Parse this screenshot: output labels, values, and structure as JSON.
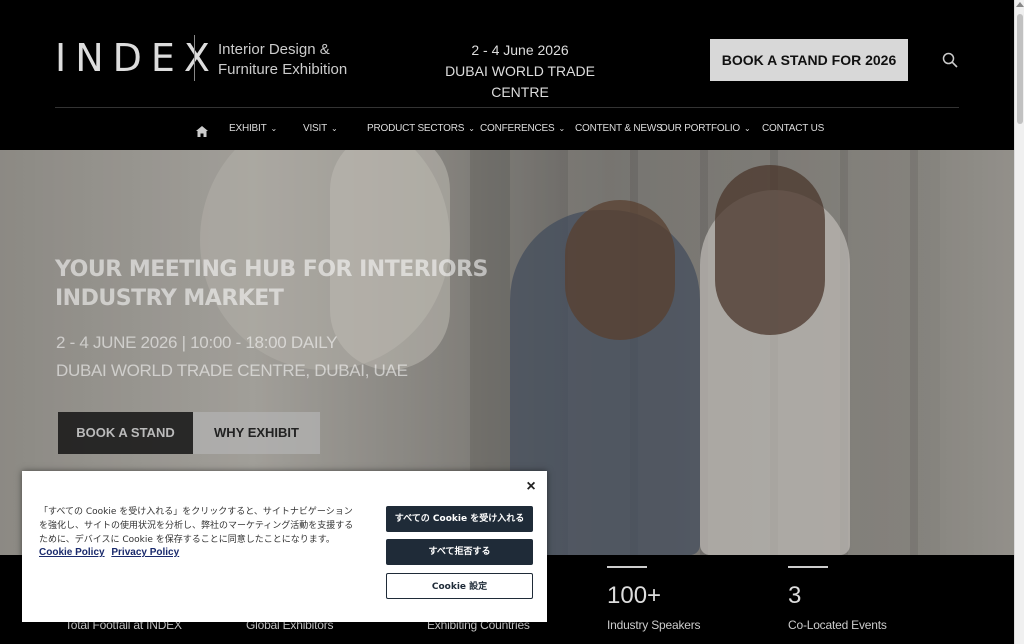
{
  "header": {
    "logo": "INDEX",
    "tagline_line1": "Interior Design &",
    "tagline_line2": "Furniture Exhibition",
    "dates": "2 - 4 June 2026",
    "venue": "DUBAI WORLD TRADE CENTRE",
    "book_button": "BOOK A STAND FOR 2026"
  },
  "nav": {
    "items": [
      {
        "label": "EXHIBIT",
        "dropdown": true
      },
      {
        "label": "VISIT",
        "dropdown": true
      },
      {
        "label": "PRODUCT SECTORS",
        "dropdown": true
      },
      {
        "label": "CONFERENCES",
        "dropdown": true
      },
      {
        "label": "CONTENT & NEWS",
        "dropdown": false
      },
      {
        "label": "OUR PORTFOLIO",
        "dropdown": true
      },
      {
        "label": "CONTACT US",
        "dropdown": false
      }
    ]
  },
  "hero": {
    "title_line1": "YOUR MEETING HUB FOR INTERIORS",
    "title_line2": "INDUSTRY MARKET",
    "date_line": "2 - 4 JUNE 2026 | 10:00 - 18:00 DAILY",
    "venue_line": "DUBAI WORLD TRADE CENTRE, DUBAI, UAE",
    "button_primary": "BOOK A STAND",
    "button_secondary": "WHY EXHIBIT"
  },
  "stats": [
    {
      "number": "",
      "label": "Total Footfall at INDEX"
    },
    {
      "number": "",
      "label": "Global Exhibitors"
    },
    {
      "number": "",
      "label": "Exhibiting Countries"
    },
    {
      "number": "100+",
      "label": "Industry Speakers"
    },
    {
      "number": "3",
      "label": "Co-Located Events"
    }
  ],
  "cookie": {
    "text": "「すべての Cookie を受け入れる」をクリックすると、サイトナビゲーションを強化し、サイトの使用状況を分析し、弊社のマーケティング活動を支援するために、デバイスに Cookie を保存することに同意したことになります。",
    "link_policy": "Cookie Policy",
    "link_privacy": "Privacy Policy",
    "accept_all": "すべての Cookie を受け入れる",
    "reject_all": "すべて拒否する",
    "settings": "Cookie 設定",
    "close": "×"
  }
}
